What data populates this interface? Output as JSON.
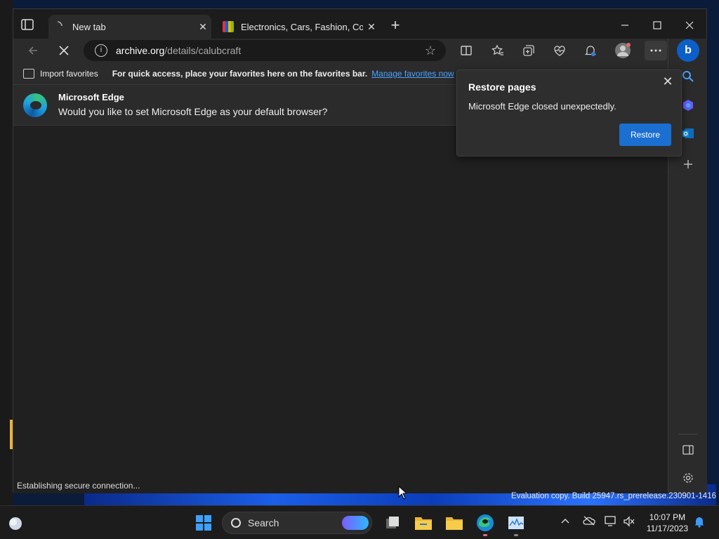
{
  "tabs": [
    {
      "title": "New tab"
    },
    {
      "title": "Electronics, Cars, Fashion, Collectibles & More | eBay"
    }
  ],
  "address": {
    "host": "archive.org",
    "path": "/details/calubcraft"
  },
  "favorites_bar": {
    "import_label": "Import favorites",
    "hint": "For quick access, place your favorites here on the favorites bar.",
    "manage_link": "Manage favorites now"
  },
  "infobar": {
    "title": "Microsoft Edge",
    "message": "Would you like to set Microsoft Edge as your default browser?"
  },
  "restore_popup": {
    "title": "Restore pages",
    "message": "Microsoft Edge closed unexpectedly.",
    "button": "Restore"
  },
  "status": "Establishing secure connection...",
  "watermark": "Evaluation copy. Build 25947.rs_prerelease.230901-1416",
  "taskbar": {
    "search_label": "Search",
    "time": "10:07 PM",
    "date": "11/17/2023"
  }
}
